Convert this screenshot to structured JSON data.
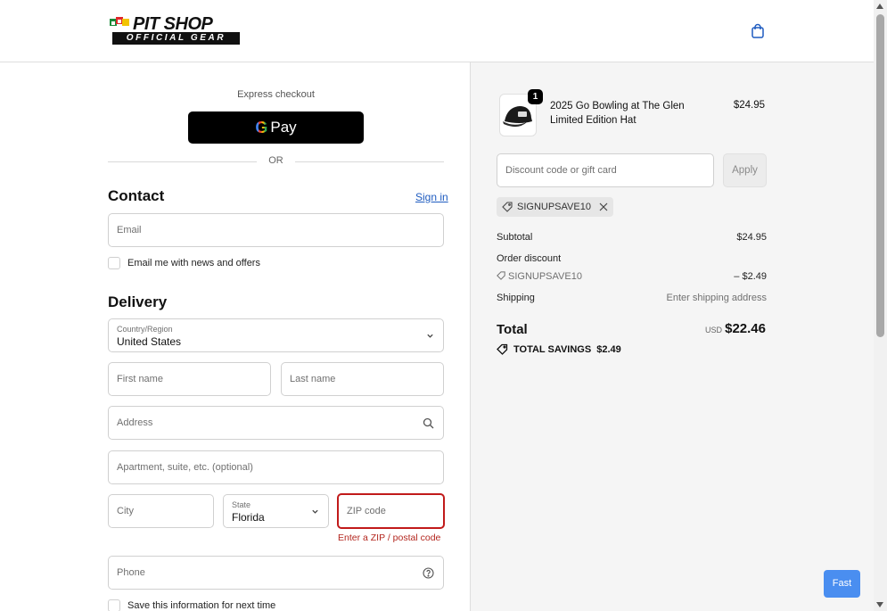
{
  "brand": {
    "top": "PIT SHOP",
    "bottom": "OFFICIAL GEAR"
  },
  "express": {
    "label": "Express checkout",
    "gpay_label": "Pay",
    "gpay_g": "G",
    "or": "OR"
  },
  "contact": {
    "title": "Contact",
    "signin": "Sign in",
    "email_placeholder": "Email",
    "newsletter_label": "Email me with news and offers"
  },
  "delivery": {
    "title": "Delivery",
    "country_label": "Country/Region",
    "country_value": "United States",
    "first_name": "First name",
    "last_name": "Last name",
    "address": "Address",
    "apartment": "Apartment, suite, etc. (optional)",
    "city": "City",
    "state_label": "State",
    "state_value": "Florida",
    "zip": "ZIP code",
    "zip_error": "Enter a ZIP / postal code",
    "phone": "Phone",
    "save_info": "Save this information for next time"
  },
  "summary": {
    "item": {
      "qty": "1",
      "name": "2025 Go Bowling at The Glen Limited Edition Hat",
      "price": "$24.95"
    },
    "discount_placeholder": "Discount code or gift card",
    "apply": "Apply",
    "code": "SIGNUPSAVE10",
    "subtotal_label": "Subtotal",
    "subtotal_value": "$24.95",
    "order_discount_label": "Order discount",
    "discount_code": "SIGNUPSAVE10",
    "discount_value": "– $2.49",
    "shipping_label": "Shipping",
    "shipping_value": "Enter shipping address",
    "total_label": "Total",
    "currency": "USD",
    "total_value": "$22.46",
    "savings_label": "TOTAL SAVINGS",
    "savings_value": "$2.49"
  },
  "fast_button": "Fast",
  "colors": {
    "accent": "#1f5cc0",
    "error": "#c11a1a",
    "fast": "#4a8ef0",
    "summary_bg": "#f5f5f5"
  }
}
